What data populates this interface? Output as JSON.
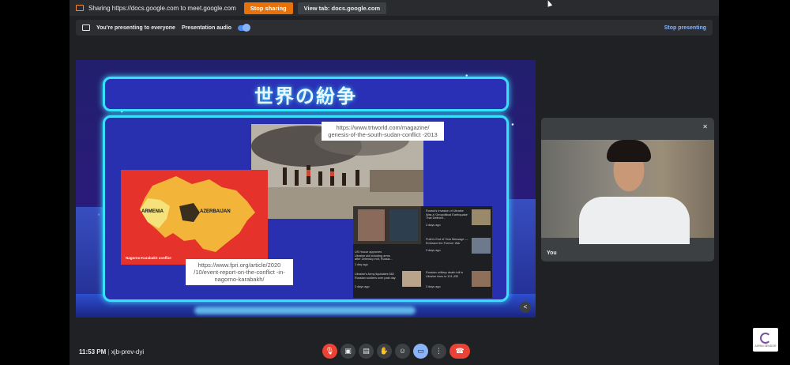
{
  "share_bar": {
    "message": "Sharing https://docs.google.com to meet.google.com",
    "stop_label": "Stop sharing",
    "view_tab_label": "View tab: docs.google.com"
  },
  "presenting_bar": {
    "status": "You're presenting to everyone",
    "audio_label": "Presentation audio",
    "stop_label": "Stop presenting"
  },
  "slide": {
    "title": "世界の紛争",
    "map_labels": {
      "armenia": "ARMENIA",
      "azerbaijan": "AZERBAIJAN",
      "caption": "Nagorno-Karabakh conflict"
    },
    "caption_trt": "https://www.trtworld.com/magazine/ genesis-of-the-south-sudan-conflict -2013",
    "caption_fpri": "https://www.fpri.org/article/2020 /10/event-report-on-the-conflict -in-nagorno-karabakh/",
    "news": [
      {
        "text": "US House approves Ukraine aid including arms after Zelensky exit, Russia...",
        "age": "1 day ago"
      },
      {
        "text": "Russia's Invasion of Ukraine Was a 'Geopolitical Earthquake' That Defined...",
        "age": "3 days ago"
      },
      {
        "text": "Ukraine's Army liquidates 582 Russian soldiers over past day",
        "age": "2 days ago"
      },
      {
        "text": "Putin's End of Year Message — Embrace the Forever War",
        "age": "3 days ago"
      },
      {
        "text": "Russian military death toll in Ukraine rises to 101,430",
        "age": "3 days ago"
      }
    ]
  },
  "self_tile": {
    "name": "You"
  },
  "bottom": {
    "time": "11:53 PM",
    "separator": "|",
    "meeting_code": "xjb-prev-dyi"
  },
  "logo": {
    "text": "JAPAN SENDOR"
  },
  "colors": {
    "accent": "#38e0ff",
    "stop_orange": "#e8710a",
    "hangup_red": "#ea4335"
  }
}
